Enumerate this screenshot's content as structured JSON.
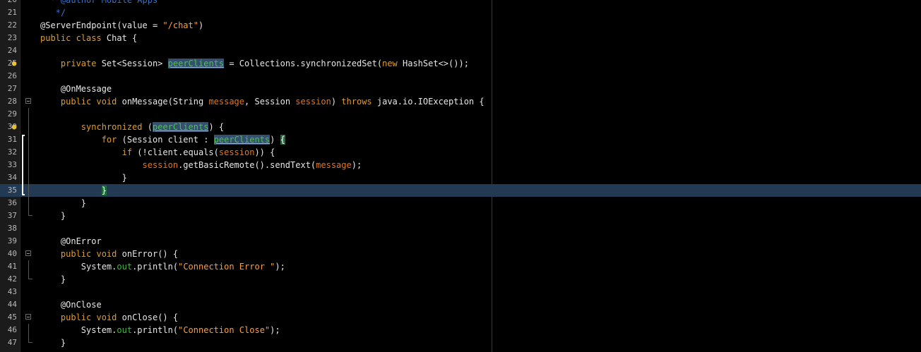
{
  "editor": {
    "lines": [
      {
        "n": "20",
        "indent": "  ",
        "tokens": [
          {
            "t": "* @author Mobile Apps",
            "c": "com"
          }
        ]
      },
      {
        "n": "21",
        "indent": "  ",
        "tokens": [
          {
            "t": " */",
            "c": "com"
          }
        ]
      },
      {
        "n": "22",
        "indent": "",
        "tokens": [
          {
            "t": "@ServerEndpoint",
            "c": "ann"
          },
          {
            "t": "(value = ",
            "c": "def"
          },
          {
            "t": "\"/chat\"",
            "c": "str"
          },
          {
            "t": ")",
            "c": "def"
          }
        ]
      },
      {
        "n": "23",
        "indent": "",
        "tokens": [
          {
            "t": "public class",
            "c": "kw"
          },
          {
            "t": " Chat {",
            "c": "def"
          }
        ]
      },
      {
        "n": "24",
        "indent": "",
        "tokens": []
      },
      {
        "n": "25",
        "indent": "    ",
        "tokens": [
          {
            "t": "private",
            "c": "kw"
          },
          {
            "t": " Set<Session> ",
            "c": "def"
          },
          {
            "t": "peerClients",
            "c": "mark"
          },
          {
            "t": " = Collections.synchronizedSet(",
            "c": "def"
          },
          {
            "t": "new",
            "c": "kw"
          },
          {
            "t": " HashSet<>());",
            "c": "def"
          }
        ],
        "bulb": true
      },
      {
        "n": "26",
        "indent": "",
        "tokens": []
      },
      {
        "n": "27",
        "indent": "    ",
        "tokens": [
          {
            "t": "@OnMessage",
            "c": "ann"
          }
        ]
      },
      {
        "n": "28",
        "indent": "    ",
        "tokens": [
          {
            "t": "public void",
            "c": "kw"
          },
          {
            "t": " onMessage(String ",
            "c": "def"
          },
          {
            "t": "message",
            "c": "param"
          },
          {
            "t": ", Session ",
            "c": "def"
          },
          {
            "t": "session",
            "c": "param"
          },
          {
            "t": ") ",
            "c": "def"
          },
          {
            "t": "throws",
            "c": "kw"
          },
          {
            "t": " java.io.IOException {",
            "c": "def"
          }
        ],
        "fold": "box"
      },
      {
        "n": "29",
        "indent": "",
        "tokens": [],
        "fold": "bar"
      },
      {
        "n": "30",
        "indent": "        ",
        "tokens": [
          {
            "t": "synchronized",
            "c": "kw"
          },
          {
            "t": " (",
            "c": "def"
          },
          {
            "t": "peerClients",
            "c": "mark"
          },
          {
            "t": ") {",
            "c": "def"
          }
        ],
        "bulb": true,
        "fold": "bar"
      },
      {
        "n": "31",
        "indent": "            ",
        "tokens": [
          {
            "t": "for",
            "c": "kw"
          },
          {
            "t": " (Session client : ",
            "c": "def"
          },
          {
            "t": "peerClients",
            "c": "mark"
          },
          {
            "t": ") ",
            "c": "def"
          },
          {
            "t": "{",
            "c": "brace"
          }
        ],
        "fold": "bar",
        "scope": "top"
      },
      {
        "n": "32",
        "indent": "                ",
        "tokens": [
          {
            "t": "if",
            "c": "kw"
          },
          {
            "t": " (!client.equals(",
            "c": "def"
          },
          {
            "t": "session",
            "c": "param"
          },
          {
            "t": ")) {",
            "c": "def"
          }
        ],
        "fold": "bar",
        "scope": "mid"
      },
      {
        "n": "33",
        "indent": "                    ",
        "tokens": [
          {
            "t": "session",
            "c": "param"
          },
          {
            "t": ".getBasicRemote().sendText(",
            "c": "def"
          },
          {
            "t": "message",
            "c": "param"
          },
          {
            "t": ");",
            "c": "def"
          }
        ],
        "fold": "bar",
        "scope": "mid"
      },
      {
        "n": "34",
        "indent": "                ",
        "tokens": [
          {
            "t": "}",
            "c": "def"
          }
        ],
        "fold": "bar",
        "scope": "mid"
      },
      {
        "n": "35",
        "indent": "            ",
        "tokens": [
          {
            "t": "}",
            "c": "brace"
          }
        ],
        "fold": "bar",
        "scope": "bottom",
        "current": true
      },
      {
        "n": "36",
        "indent": "        ",
        "tokens": [
          {
            "t": "}",
            "c": "def"
          }
        ],
        "fold": "bar"
      },
      {
        "n": "37",
        "indent": "    ",
        "tokens": [
          {
            "t": "}",
            "c": "def"
          }
        ],
        "fold": "end"
      },
      {
        "n": "38",
        "indent": "",
        "tokens": []
      },
      {
        "n": "39",
        "indent": "    ",
        "tokens": [
          {
            "t": "@OnError",
            "c": "ann"
          }
        ]
      },
      {
        "n": "40",
        "indent": "    ",
        "tokens": [
          {
            "t": "public void",
            "c": "kw"
          },
          {
            "t": " onError() {",
            "c": "def"
          }
        ],
        "fold": "box"
      },
      {
        "n": "41",
        "indent": "        ",
        "tokens": [
          {
            "t": "System.",
            "c": "def"
          },
          {
            "t": "out",
            "c": "field"
          },
          {
            "t": ".println(",
            "c": "def"
          },
          {
            "t": "\"Connection Error \"",
            "c": "str"
          },
          {
            "t": ");",
            "c": "def"
          }
        ],
        "fold": "bar"
      },
      {
        "n": "42",
        "indent": "    ",
        "tokens": [
          {
            "t": "}",
            "c": "def"
          }
        ],
        "fold": "end"
      },
      {
        "n": "43",
        "indent": "",
        "tokens": []
      },
      {
        "n": "44",
        "indent": "    ",
        "tokens": [
          {
            "t": "@OnClose",
            "c": "ann"
          }
        ]
      },
      {
        "n": "45",
        "indent": "    ",
        "tokens": [
          {
            "t": "public void",
            "c": "kw"
          },
          {
            "t": " onClose() {",
            "c": "def"
          }
        ],
        "fold": "box"
      },
      {
        "n": "46",
        "indent": "        ",
        "tokens": [
          {
            "t": "System.",
            "c": "def"
          },
          {
            "t": "out",
            "c": "field"
          },
          {
            "t": ".println(",
            "c": "def"
          },
          {
            "t": "\"Connection Close\"",
            "c": "str"
          },
          {
            "t": ");",
            "c": "def"
          }
        ],
        "fold": "bar"
      },
      {
        "n": "47",
        "indent": "    ",
        "tokens": [
          {
            "t": "}",
            "c": "def"
          }
        ],
        "fold": "end"
      }
    ]
  },
  "colors": {
    "background": "#000000",
    "keyword": "#e59b22",
    "string": "#ff9d3a",
    "parameter": "#e5751a",
    "static-field": "#3dbb3d",
    "comment": "#3b6fc6",
    "current-line": "#233a55"
  },
  "icons": {
    "hint": "lightbulb-icon",
    "fold": "fold-collapse-icon"
  }
}
